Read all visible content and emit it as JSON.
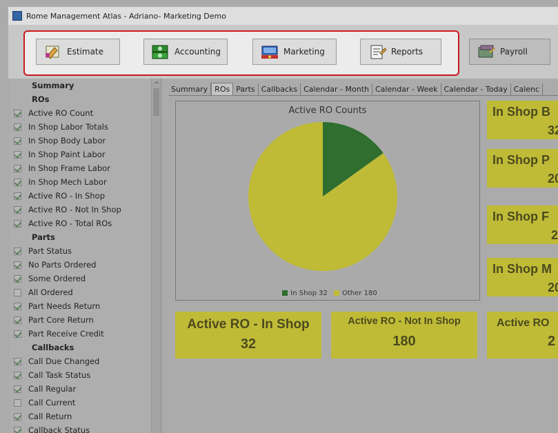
{
  "window": {
    "title": "Rome Management Atlas - Adriano- Marketing Demo"
  },
  "toolbar": {
    "buttons": [
      {
        "label": "Estimate",
        "icon": "estimate-icon"
      },
      {
        "label": "Accounting",
        "icon": "money-icon"
      },
      {
        "label": "Marketing",
        "icon": "marketing-icon"
      },
      {
        "label": "Reports",
        "icon": "reports-icon"
      },
      {
        "label": "Payroll",
        "icon": "payroll-icon"
      }
    ],
    "highlight_color": "#c8181e"
  },
  "sidebar": {
    "items": [
      {
        "label": "Summary",
        "type": "header"
      },
      {
        "label": "ROs",
        "type": "header"
      },
      {
        "label": "Active RO Count",
        "checked": true
      },
      {
        "label": "In Shop Labor Totals",
        "checked": true
      },
      {
        "label": "In Shop Body Labor",
        "checked": true
      },
      {
        "label": "In Shop Paint Labor",
        "checked": true
      },
      {
        "label": "In Shop Frame Labor",
        "checked": true
      },
      {
        "label": "In Shop Mech Labor",
        "checked": true
      },
      {
        "label": "Active RO - In Shop",
        "checked": true
      },
      {
        "label": "Active RO - Not In Shop",
        "checked": true
      },
      {
        "label": "Active RO - Total ROs",
        "checked": true
      },
      {
        "label": "Parts",
        "type": "header"
      },
      {
        "label": "Part Status",
        "checked": true
      },
      {
        "label": "No Parts Ordered",
        "checked": true
      },
      {
        "label": "Some Ordered",
        "checked": true
      },
      {
        "label": "All Ordered",
        "checked": false
      },
      {
        "label": "Part Needs Return",
        "checked": true
      },
      {
        "label": "Part Core Return",
        "checked": true
      },
      {
        "label": "Part Receive Credit",
        "checked": true
      },
      {
        "label": "Callbacks",
        "type": "header"
      },
      {
        "label": "Call Due Changed",
        "checked": true
      },
      {
        "label": "Call Task Status",
        "checked": true
      },
      {
        "label": "Call Regular",
        "checked": true
      },
      {
        "label": "Call Current",
        "checked": false
      },
      {
        "label": "Call Return",
        "checked": true
      },
      {
        "label": "Callback Status",
        "checked": true
      }
    ],
    "scroll_up": "^"
  },
  "tabs": [
    {
      "label": "Summary",
      "active": false
    },
    {
      "label": "ROs",
      "active": true
    },
    {
      "label": "Parts",
      "active": false
    },
    {
      "label": "Callbacks",
      "active": false
    },
    {
      "label": "Calendar - Month",
      "active": false
    },
    {
      "label": "Calendar - Week",
      "active": false
    },
    {
      "label": "Calendar - Today",
      "active": false
    },
    {
      "label": "Calenc",
      "active": false
    }
  ],
  "chart_data": {
    "type": "pie",
    "title": "Active RO Counts",
    "categories": [
      "In Shop",
      "Other"
    ],
    "values": [
      32,
      180
    ],
    "colors": [
      "#2f6e2f",
      "#c0bb37"
    ],
    "legend": [
      "In Shop 32",
      "Other 180"
    ],
    "legend_position": "bottom"
  },
  "tiles": {
    "bottom": [
      {
        "title": "Active RO - In Shop",
        "value": "32"
      },
      {
        "title": "Active RO - Not In Shop",
        "value": "180"
      },
      {
        "title": "Active RO",
        "value": "2"
      }
    ],
    "right": [
      {
        "title": "In Shop B",
        "value": "32"
      },
      {
        "title": "In Shop P",
        "value": "20"
      },
      {
        "title": "In Shop F",
        "value": "2"
      },
      {
        "title": "In Shop M",
        "value": "20"
      }
    ],
    "color": "#c0bb37"
  }
}
